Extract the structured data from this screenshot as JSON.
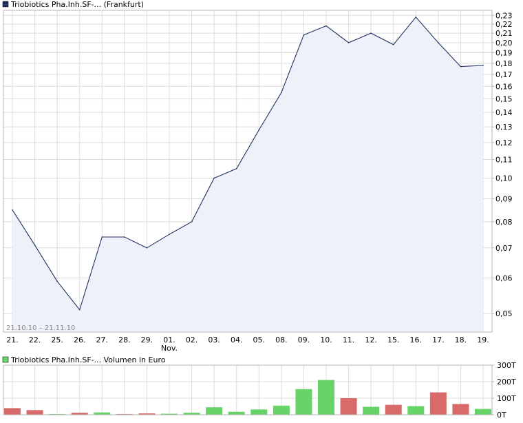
{
  "chart_data": [
    {
      "type": "area",
      "legend_label": "Triobiotics Pha.Inh.SF-... (Frankfurt)",
      "legend_color": "#1f2f5f",
      "date_range_label": "21.10.10 – 21.11.10",
      "scale": "log",
      "ylim": [
        0.0455,
        0.236
      ],
      "y_ticks": [
        "0,23",
        "0,22",
        "0,21",
        "0,20",
        "0,19",
        "0,18",
        "0,17",
        "0,16",
        "0,15",
        "0,14",
        "0,13",
        "0,12",
        "0,11",
        "0,10",
        "0,09",
        "0,08",
        "0,07",
        "0,06",
        "0,05"
      ],
      "y_tick_values": [
        0.23,
        0.22,
        0.21,
        0.2,
        0.19,
        0.18,
        0.17,
        0.16,
        0.15,
        0.14,
        0.13,
        0.12,
        0.11,
        0.1,
        0.09,
        0.08,
        0.07,
        0.06,
        0.05
      ],
      "categories": [
        "21.",
        "22.",
        "25.",
        "26.",
        "27.",
        "28.",
        "29.",
        "01.",
        "02.",
        "03.",
        "04.",
        "05.",
        "08.",
        "09.",
        "10.",
        "11.",
        "12.",
        "15.",
        "16.",
        "17.",
        "18.",
        "19."
      ],
      "month_label": {
        "index": 7,
        "text": "Nov."
      },
      "series": [
        {
          "values": [
            0.085,
            0.071,
            0.059,
            0.051,
            0.074,
            0.074,
            0.07,
            0.075,
            0.08,
            0.1,
            0.105,
            0.128,
            0.155,
            0.208,
            0.218,
            0.2,
            0.21,
            0.198,
            0.228,
            0.2,
            0.177,
            0.178
          ],
          "line_color": "#1f2f5f",
          "fill_color": "#eef0fa"
        }
      ],
      "grid": true
    },
    {
      "type": "bar",
      "legend_label": "Triobiotics Pha.Inh.SF-... Volumen in Euro",
      "legend_color": "#66d466",
      "y_ticks": [
        "300T",
        "200T",
        "100T",
        "0T"
      ],
      "y_tick_values": [
        300,
        200,
        100,
        0
      ],
      "ylim": [
        0,
        300
      ],
      "values": [
        40,
        28,
        1,
        12,
        14,
        2,
        8,
        6,
        12,
        45,
        18,
        32,
        55,
        155,
        210,
        100,
        48,
        60,
        52,
        135,
        65,
        35
      ],
      "colors": [
        "red",
        "red",
        "green",
        "red",
        "green",
        "red",
        "red",
        "green",
        "green",
        "green",
        "green",
        "green",
        "green",
        "green",
        "green",
        "red",
        "green",
        "red",
        "green",
        "red",
        "red",
        "green"
      ],
      "color_map": {
        "green": "#66d466",
        "red": "#d96a6a"
      },
      "grid": true
    }
  ]
}
